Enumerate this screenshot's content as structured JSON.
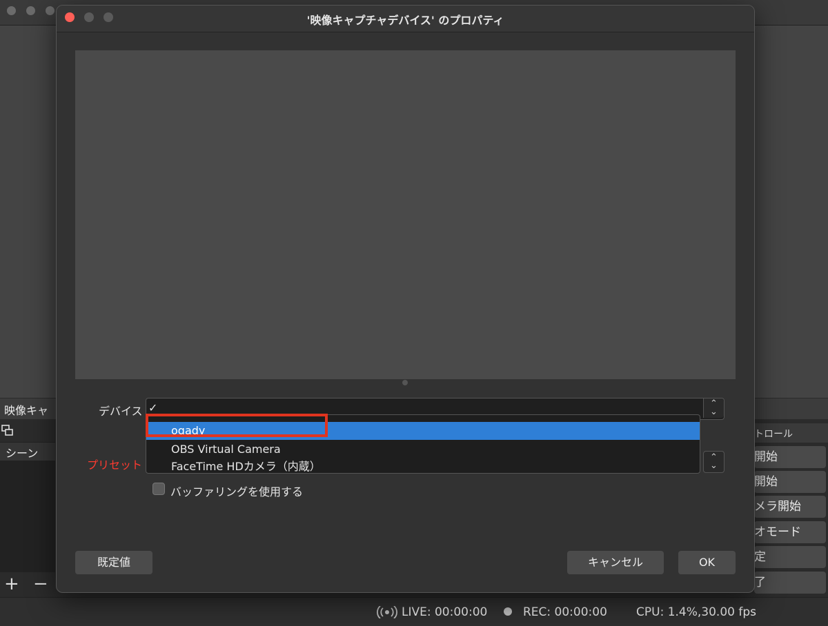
{
  "background_window": {
    "dock_title": "映像キャ",
    "scenes_label": "シーン",
    "add_symbol": "+",
    "remove_symbol": "−",
    "controls_label": "トロール",
    "control_buttons": [
      "開始",
      "開始",
      "メラ開始",
      "オモード",
      "定",
      "了"
    ],
    "status": {
      "live": "LIVE: 00:00:00",
      "rec": "REC: 00:00:00",
      "cpu": "CPU: 1.4%,30.00 fps"
    }
  },
  "dialog": {
    "title": "'映像キャプチャデバイス' のプロパティ",
    "device_label": "デバイス",
    "preset_label": "プリセット",
    "checked_mark": "✓",
    "device_options": [
      "ogady",
      "OBS Virtual Camera",
      "FaceTime HDカメラ（内蔵）"
    ],
    "selected_device": "ogady",
    "buffering_label": "バッファリングを使用する",
    "buffering_checked": false,
    "defaults_button": "既定値",
    "cancel_button": "キャンセル",
    "ok_button": "OK"
  },
  "colors": {
    "close": "#ff5f57",
    "inactive_light": "#5a5a5a",
    "selection": "#2f7fd6",
    "highlight_border": "#e0341f",
    "preset_label": "#ff3b30"
  },
  "icons": {
    "stepper": "up-down-chevron-icon",
    "live": "broadcast-icon",
    "rec": "record-dot-icon",
    "scene": "scene-layers-icon"
  }
}
